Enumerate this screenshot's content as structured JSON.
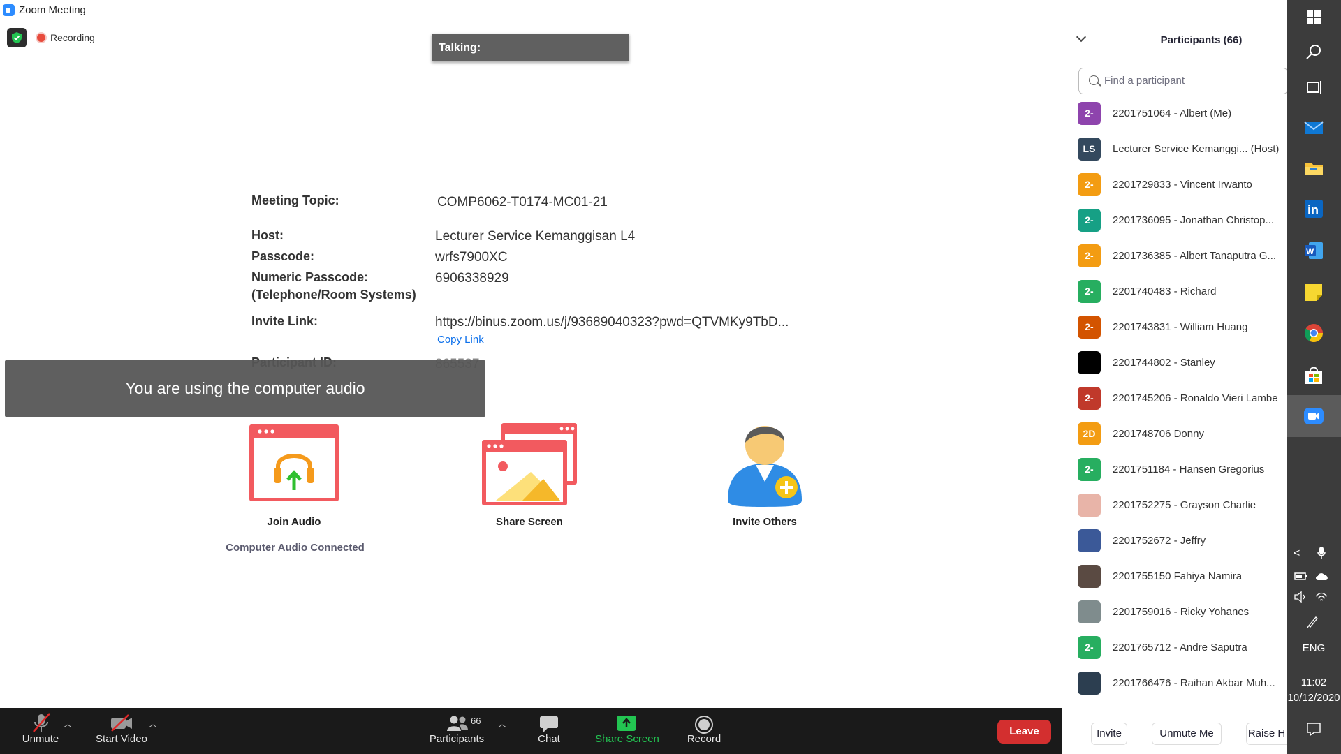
{
  "window": {
    "title": "Zoom Meeting"
  },
  "recording": {
    "label": "Recording"
  },
  "talking": {
    "label": "Talking:"
  },
  "meeting_info": {
    "topic_label": "Meeting Topic:",
    "topic_value": "COMP6062-T0174-MC01-21",
    "host_label": "Host:",
    "host_value": "Lecturer Service Kemanggisan L4",
    "passcode_label": "Passcode:",
    "passcode_value": "wrfs7900XC",
    "numeric_passcode_label": "Numeric Passcode:",
    "numeric_passcode_sublabel": "(Telephone/Room Systems)",
    "numeric_passcode_value": "6906338929",
    "invite_link_label": "Invite Link:",
    "invite_link_value": "https://binus.zoom.us/j/93689040323?pwd=QTVMKy9TbD...",
    "copy_link_label": "Copy Link",
    "participant_id_label": "Participant ID:",
    "participant_id_value": "865537"
  },
  "toast": {
    "message": "You are using the computer audio"
  },
  "actions": {
    "join_audio": "Join Audio",
    "audio_status": "Computer Audio Connected",
    "share_screen": "Share Screen",
    "invite_others": "Invite Others"
  },
  "toolbar": {
    "unmute": "Unmute",
    "start_video": "Start Video",
    "participants": "Participants",
    "participants_count": "66",
    "chat": "Chat",
    "share_screen": "Share Screen",
    "record": "Record",
    "leave": "Leave"
  },
  "panel": {
    "title": "Participants (66)",
    "search_placeholder": "Find a participant",
    "participants": [
      {
        "initials": "2-",
        "name": "2201751064 - Albert (Me)",
        "color": "#8e44ad"
      },
      {
        "initials": "LS",
        "name": "Lecturer Service Kemanggi... (Host)",
        "color": "#34495e"
      },
      {
        "initials": "2-",
        "name": "2201729833 - Vincent Irwanto",
        "color": "#f39c12"
      },
      {
        "initials": "2-",
        "name": "2201736095 - Jonathan Christop...",
        "color": "#16a085"
      },
      {
        "initials": "2-",
        "name": "2201736385 - Albert Tanaputra G...",
        "color": "#f39c12"
      },
      {
        "initials": "2-",
        "name": "2201740483 - Richard",
        "color": "#27ae60"
      },
      {
        "initials": "2-",
        "name": "2201743831 - William Huang",
        "color": "#d35400"
      },
      {
        "initials": "",
        "name": "2201744802 - Stanley",
        "color": "#000000"
      },
      {
        "initials": "2-",
        "name": "2201745206 - Ronaldo Vieri Lambe",
        "color": "#c0392b"
      },
      {
        "initials": "2D",
        "name": "2201748706 Donny",
        "color": "#f39c12"
      },
      {
        "initials": "2-",
        "name": "2201751184 - Hansen Gregorius",
        "color": "#27ae60"
      },
      {
        "initials": "",
        "name": "2201752275 - Grayson Charlie",
        "color": "#e8b4a8"
      },
      {
        "initials": "",
        "name": "2201752672 - Jeffry",
        "color": "#3b5998"
      },
      {
        "initials": "",
        "name": "2201755150 Fahiya Namira",
        "color": "#5a4a42"
      },
      {
        "initials": "",
        "name": "2201759016 - Ricky Yohanes",
        "color": "#7f8c8d"
      },
      {
        "initials": "2-",
        "name": "2201765712 - Andre Saputra",
        "color": "#27ae60"
      },
      {
        "initials": "",
        "name": "2201766476 - Raihan Akbar Muh...",
        "color": "#2c3e50"
      }
    ],
    "footer": {
      "invite": "Invite",
      "unmute_me": "Unmute Me",
      "raise_hand": "Raise H"
    }
  },
  "taskbar": {
    "language": "ENG",
    "time": "11:02",
    "date": "10/12/2020"
  }
}
